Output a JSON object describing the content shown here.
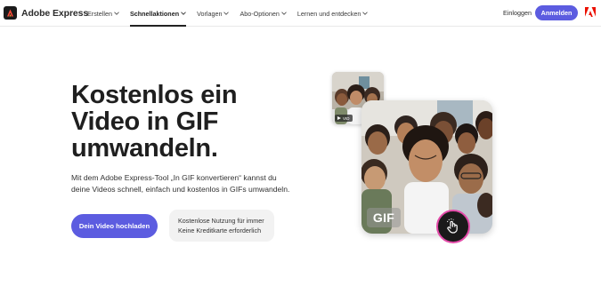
{
  "brand": {
    "name": "Adobe Express"
  },
  "nav": {
    "items": [
      {
        "label": "Erstellen",
        "active": false
      },
      {
        "label": "Schnellaktionen",
        "active": true
      },
      {
        "label": "Vorlagen",
        "active": false
      },
      {
        "label": "Abo-Optionen",
        "active": false
      },
      {
        "label": "Lernen und entdecken",
        "active": false
      }
    ],
    "signin": "Einloggen",
    "signup": "Anmelden"
  },
  "hero": {
    "title": "Kostenlos ein Video in GIF umwandeln.",
    "description": "Mit dem Adobe Express-Tool „In GIF konvertieren“ kannst du deine Videos schnell, einfach und kostenlos in GIFs umwandeln.",
    "cta": "Dein Video hochladen",
    "note_line1": "Kostenlose Nutzung für immer",
    "note_line2": "Keine Kreditkarte erforderlich"
  },
  "media": {
    "thumb_badge": "VID",
    "gif_label": "GIF"
  },
  "colors": {
    "accent": "#5c5ce0",
    "adobe_red": "#eb1000",
    "ring": "#e34aa8"
  },
  "icons": [
    "adobe-express-logo-icon",
    "chevron-down-icon",
    "adobe-logo-icon",
    "video-icon",
    "hand-tap-icon"
  ]
}
